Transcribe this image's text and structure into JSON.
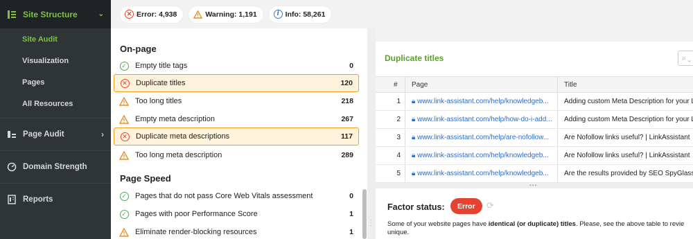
{
  "sidebar": {
    "header": "Site Structure",
    "sub_items": [
      {
        "label": "Site Audit",
        "active": true
      },
      {
        "label": "Visualization"
      },
      {
        "label": "Pages"
      },
      {
        "label": "All Resources"
      }
    ],
    "items": [
      {
        "label": "Page Audit",
        "icon": "page-audit-icon"
      },
      {
        "label": "Domain Strength",
        "icon": "gauge-icon"
      },
      {
        "label": "Reports",
        "icon": "report-icon"
      }
    ]
  },
  "summary": {
    "error": "Error: 4,938",
    "warning": "Warning: 1,191",
    "info": "Info: 58,261"
  },
  "factors": {
    "onpage_title": "On-page",
    "onpage": [
      {
        "label": "Empty title tags",
        "count": "0",
        "status": "ok"
      },
      {
        "label": "Duplicate titles",
        "count": "120",
        "status": "error",
        "selected": true
      },
      {
        "label": "Too long titles",
        "count": "218",
        "status": "warning"
      },
      {
        "label": "Empty meta description",
        "count": "267",
        "status": "warning"
      },
      {
        "label": "Duplicate meta descriptions",
        "count": "117",
        "status": "error",
        "selected": true
      },
      {
        "label": "Too long meta description",
        "count": "289",
        "status": "warning"
      }
    ],
    "speed_title": "Page Speed",
    "speed": [
      {
        "label": "Pages that do not pass Core Web Vitals assessment",
        "count": "0",
        "status": "ok"
      },
      {
        "label": "Pages with poor Performance Score",
        "count": "1",
        "status": "ok"
      },
      {
        "label": "Eliminate render-blocking resources",
        "count": "1",
        "status": "warning"
      }
    ]
  },
  "detail": {
    "title": "Duplicate titles",
    "columns": {
      "num": "#",
      "page": "Page",
      "title": "Title"
    },
    "rows": [
      {
        "num": "1",
        "page": "www.link-assistant.com/help/knowledgeb...",
        "title": "Adding custom Meta Description for your L"
      },
      {
        "num": "2",
        "page": "www.link-assistant.com/help/how-do-i-add...",
        "title": "Adding custom Meta Description for your L"
      },
      {
        "num": "3",
        "page": "www.link-assistant.com/help/are-nofollow...",
        "title": "Are Nofollow links useful? | LinkAssistant"
      },
      {
        "num": "4",
        "page": "www.link-assistant.com/help/knowledgeb...",
        "title": "Are Nofollow links useful? | LinkAssistant"
      },
      {
        "num": "5",
        "page": "www.link-assistant.com/help/knowledgeb...",
        "title": "Are the results provided by SEO SpyGlass"
      }
    ]
  },
  "factor_status": {
    "label": "Factor status:",
    "badge": "Error",
    "desc_before": "Some of your website pages have ",
    "desc_bold": "identical (or duplicate) titles",
    "desc_after": ". Please, see the above table to revie",
    "desc_line2": "unique."
  },
  "colors": {
    "accent_green": "#7ec04a",
    "error_red": "#e4442f",
    "warning_orange": "#f08c28",
    "info_blue": "#2f7bd6"
  }
}
